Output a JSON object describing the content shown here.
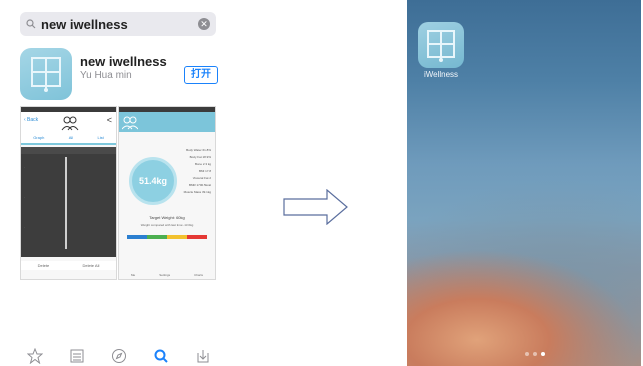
{
  "search": {
    "query": "new iwellness"
  },
  "app": {
    "name": "new iwellness",
    "developer": "Yu Hua min",
    "open_label": "打开"
  },
  "screenshot1": {
    "back": "‹ Back",
    "tabs": [
      "Graph",
      "All",
      "List"
    ],
    "buttons": [
      "Delete",
      "Delete All"
    ]
  },
  "screenshot2": {
    "weight": "51.4kg",
    "target": "Target Weight: 60kg",
    "compare": "Weight compared with last time:-13.6kg",
    "list": [
      "Body Water 61.8%",
      "Body Fat 18.9%",
      "Bone 2.3 kg",
      "BMI 17.8",
      "Visceral Fat 2",
      "BMR 1700.5kcal",
      "Muscle Mass 39.1kg"
    ],
    "footer": [
      "Me",
      "Settings",
      "Charts"
    ]
  },
  "home": {
    "app_label": "iWellness"
  },
  "colors": {
    "accent": "#1a82fb",
    "teal": "#7cc5da",
    "arrow": "#5a6e9e"
  },
  "icons": {
    "tabbar": [
      "star-icon",
      "list-icon",
      "compass-icon",
      "search-icon",
      "download-icon"
    ]
  }
}
